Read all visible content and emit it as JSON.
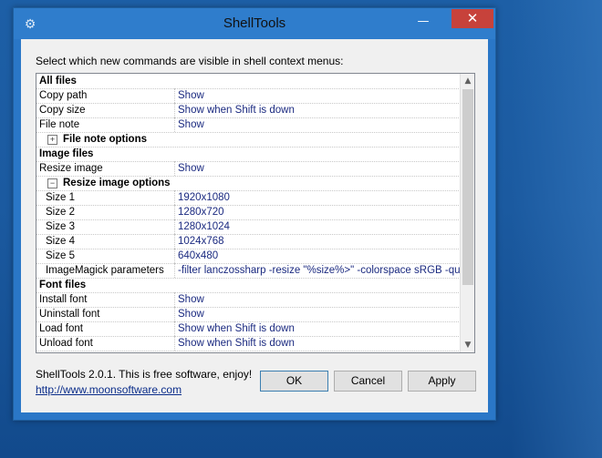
{
  "window": {
    "title": "ShellTools",
    "minimize_glyph": "—",
    "close_glyph": "✕",
    "icon": "gear-icon"
  },
  "instruction": "Select which new commands are visible in shell context menus:",
  "grid": {
    "rows": [
      {
        "type": "category",
        "name": "All files"
      },
      {
        "type": "item",
        "name": "Copy path",
        "value": "Show"
      },
      {
        "type": "item",
        "name": "Copy size",
        "value": "Show when Shift is down"
      },
      {
        "type": "item",
        "name": "File note",
        "value": "Show"
      },
      {
        "type": "group",
        "expander": "+",
        "name": "File note options"
      },
      {
        "type": "category",
        "name": "Image files"
      },
      {
        "type": "item",
        "name": "Resize image",
        "value": "Show"
      },
      {
        "type": "group",
        "expander": "−",
        "name": "Resize image options"
      },
      {
        "type": "subitem",
        "name": "Size 1",
        "value": "1920x1080"
      },
      {
        "type": "subitem",
        "name": "Size 2",
        "value": "1280x720"
      },
      {
        "type": "subitem",
        "name": "Size 3",
        "value": "1280x1024"
      },
      {
        "type": "subitem",
        "name": "Size 4",
        "value": "1024x768"
      },
      {
        "type": "subitem",
        "name": "Size 5",
        "value": "640x480"
      },
      {
        "type": "subitem",
        "name": "ImageMagick parameters",
        "value": "-filter lanczossharp -resize \"%size%>\" -colorspace sRGB -quality"
      },
      {
        "type": "category",
        "name": "Font files"
      },
      {
        "type": "item",
        "name": "Install font",
        "value": "Show"
      },
      {
        "type": "item",
        "name": "Uninstall font",
        "value": "Show"
      },
      {
        "type": "item",
        "name": "Load font",
        "value": "Show when Shift is down"
      },
      {
        "type": "item",
        "name": "Unload font",
        "value": "Show when Shift is down"
      }
    ]
  },
  "footer": {
    "version": "ShellTools 2.0.1. This is free software, enjoy!",
    "link": "http://www.moonsoftware.com",
    "ok_label": "OK",
    "cancel_label": "Cancel",
    "apply_label": "Apply"
  },
  "colors": {
    "title_bar": "#2f7dcc",
    "close_button": "#c7423b",
    "value_text": "#1b2a80",
    "link": "#0b2d8a"
  }
}
